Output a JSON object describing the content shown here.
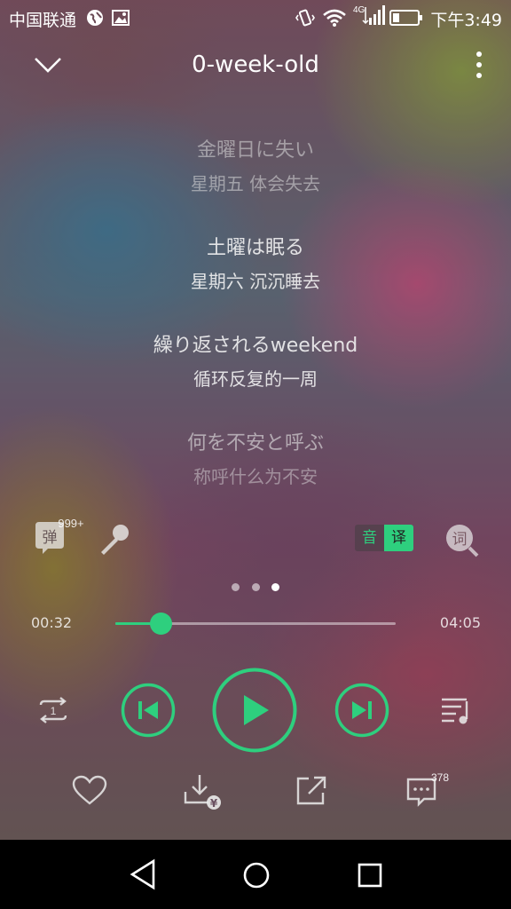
{
  "status_bar": {
    "carrier": "中国联通",
    "network": "4G",
    "time": "下午3:49"
  },
  "header": {
    "title": "0-week-old"
  },
  "lyrics": [
    {
      "original": "金曜日に失い",
      "translation": "星期五 体会失去"
    },
    {
      "original": "土曜は眠る",
      "translation": "星期六 沉沉睡去"
    },
    {
      "original": "繰り返されるweekend",
      "translation": "循环反复的一周"
    },
    {
      "original": "何を不安と呼ぶ",
      "translation": "称呼什么为不安"
    }
  ],
  "tools": {
    "danmaku_label": "弹",
    "danmaku_count": "999+",
    "lyric_mode_sound": "音",
    "lyric_mode_translate": "译",
    "lyric_search_label": "词"
  },
  "pager": {
    "count": 3,
    "active_index": 2
  },
  "progress": {
    "current": "00:32",
    "total": "04:05",
    "fraction": 0.16
  },
  "playback": {
    "repeat_label": "1",
    "state": "paused"
  },
  "actions": {
    "comment_count": "378",
    "download_badge": "¥"
  },
  "colors": {
    "accent": "#2ecf7e"
  }
}
